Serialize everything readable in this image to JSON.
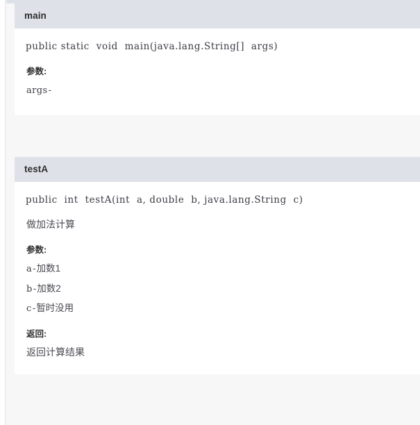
{
  "page": {
    "clipped_header_above": "",
    "colors": {
      "header_bg": "#dee2e8",
      "page_bg": "#f7f7f8",
      "card_bg": "#ffffff",
      "text": "#4a4a52",
      "heading": "#2e2e2e",
      "code": "#3b3b44",
      "rule": "#e4e4e6"
    }
  },
  "methods": [
    {
      "name": "main",
      "signature": "public static  void  main(java.lang.String[]  args)",
      "description": "",
      "params_label": "参数:",
      "params": [
        {
          "term": "args",
          "dash": "-",
          "desc": ""
        }
      ],
      "returns_label": "",
      "returns": ""
    },
    {
      "name": "testA",
      "signature": "public  int  testA(int  a, double  b, java.lang.String  c)",
      "description": "做加法计算",
      "params_label": "参数:",
      "params": [
        {
          "term": "a",
          "dash": "-",
          "desc": "加数1"
        },
        {
          "term": "b",
          "dash": "-",
          "desc": "加数2"
        },
        {
          "term": "c",
          "dash": "-",
          "desc": "暂时没用"
        }
      ],
      "returns_label": "返回:",
      "returns": "返回计算结果"
    }
  ]
}
